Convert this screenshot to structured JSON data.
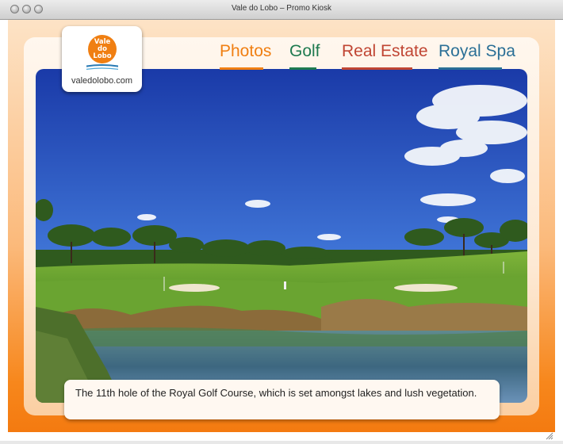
{
  "window": {
    "title": "Vale do Lobo – Promo Kiosk"
  },
  "logo": {
    "emblem_lines": [
      "Vale",
      "do",
      "Lobo"
    ],
    "url": "valedolobo.com"
  },
  "nav": {
    "items": [
      {
        "label": "Photos",
        "color": "#f07f12",
        "active": true
      },
      {
        "label": "Golf",
        "color": "#1e7a4f",
        "active": false
      },
      {
        "label": "Real Estate",
        "color": "#c04533",
        "active": false
      },
      {
        "label": "Royal Spa",
        "color": "#2a6f96",
        "active": false
      }
    ]
  },
  "photo": {
    "subject": "golf course with lake and pine trees"
  },
  "caption": {
    "text": "The 11th hole of the Royal Golf Course, which is set amongst lakes and lush vegetation."
  },
  "colors": {
    "brand_orange": "#f47a10",
    "panel": "#fde9d4"
  }
}
